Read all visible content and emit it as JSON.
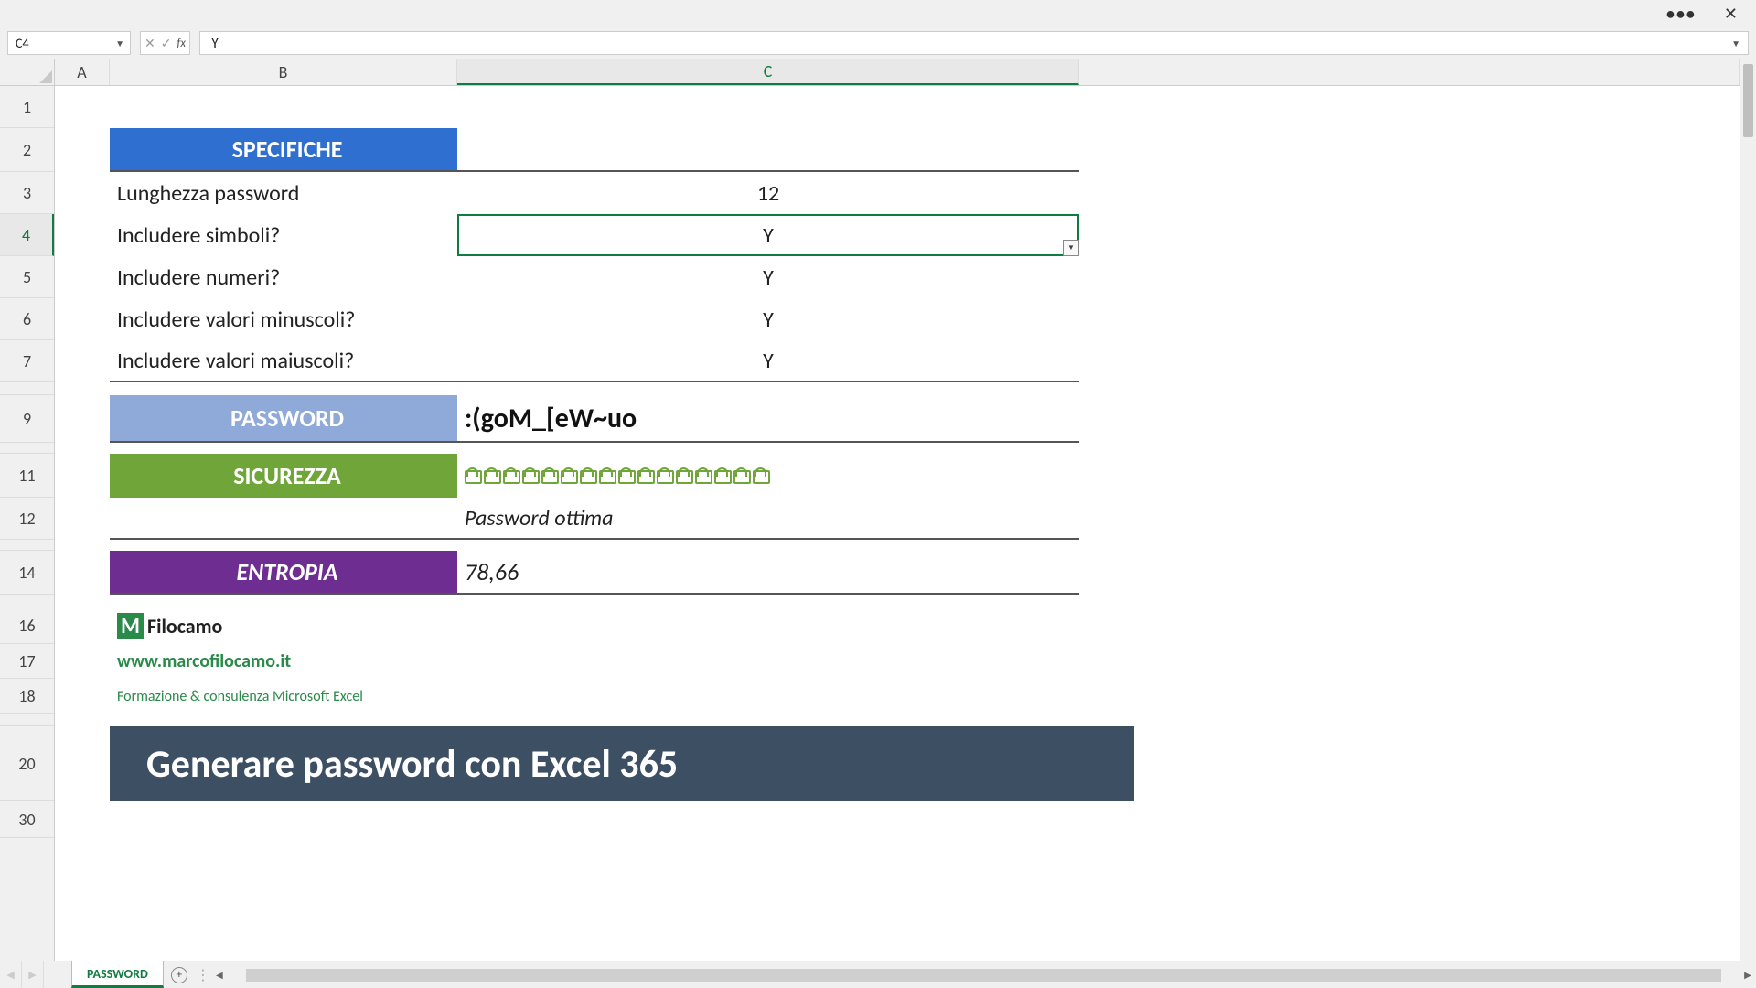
{
  "titlebar": {
    "more": "•••",
    "close": "✕"
  },
  "namebox": {
    "value": "C4"
  },
  "formula": {
    "value": "Y"
  },
  "columns": {
    "A": "A",
    "B": "B",
    "C": "C"
  },
  "rows": [
    "1",
    "2",
    "3",
    "4",
    "5",
    "6",
    "7",
    "9",
    "11",
    "12",
    "14",
    "16",
    "17",
    "18",
    "20",
    "30"
  ],
  "headers": {
    "specifiche": "SPECIFICHE",
    "password": "PASSWORD",
    "sicurezza": "SICUREZZA",
    "entropia": "ENTROPIA"
  },
  "spec": {
    "length_label": "Lunghezza password",
    "length_value": "12",
    "symbols_label": "Includere simboli?",
    "symbols_value": "Y",
    "numbers_label": "Includere numeri?",
    "numbers_value": "Y",
    "lowercase_label": "Includere valori minuscoli?",
    "lowercase_value": "Y",
    "uppercase_label": "Includere valori maiuscoli?",
    "uppercase_value": "Y"
  },
  "password_value": ":(goM_[eW~uo",
  "security": {
    "rating_text": "Password ottima",
    "lock_count": 16
  },
  "entropy_value": "78,66",
  "branding": {
    "logo_m": "M",
    "logo_text": "Filocamo",
    "site": "www.marcofilocamo.it",
    "tagline": "Formazione & consulenza Microsoft Excel"
  },
  "big_title": "Generare password con Excel 365",
  "sheet": {
    "name": "PASSWORD"
  }
}
